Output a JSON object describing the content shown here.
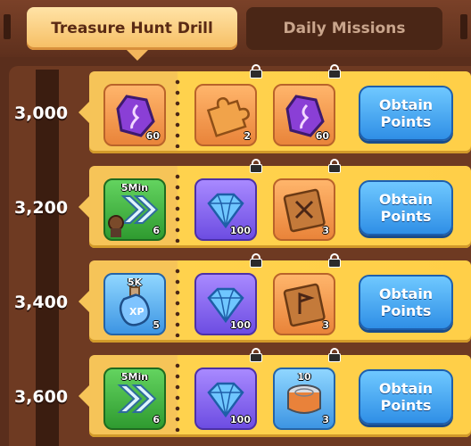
{
  "tabs": [
    {
      "label": "Treasure Hunt Drill",
      "active": true
    },
    {
      "label": "Daily Missions",
      "active": false
    }
  ],
  "rows": [
    {
      "points": "3,000",
      "button": "Obtain\nPoints",
      "rewards": [
        {
          "icon": "purple-rune-stone-icon",
          "qty": "60",
          "locked": false
        },
        {
          "icon": "puzzle-piece-icon",
          "qty": "2",
          "locked": true
        },
        {
          "icon": "purple-rune-stone-icon",
          "qty": "60",
          "locked": true
        }
      ]
    },
    {
      "points": "3,200",
      "button": "Obtain\nPoints",
      "rewards": [
        {
          "icon": "speedup-hero-icon",
          "tag": "5Min",
          "qty": "6",
          "locked": false
        },
        {
          "icon": "blue-diamond-icon",
          "qty": "100",
          "locked": true
        },
        {
          "icon": "crossed-swords-book-icon",
          "qty": "3",
          "locked": true
        }
      ]
    },
    {
      "points": "3,400",
      "button": "Obtain\nPoints",
      "rewards": [
        {
          "icon": "xp-potion-icon",
          "tag": "5K",
          "qty": "5",
          "locked": false
        },
        {
          "icon": "blue-diamond-icon",
          "qty": "100",
          "locked": true
        },
        {
          "icon": "flag-book-icon",
          "qty": "3",
          "locked": true
        }
      ]
    },
    {
      "points": "3,600",
      "button": "Obtain\nPoints",
      "rewards": [
        {
          "icon": "speedup-icon",
          "tag": "5Min",
          "qty": "6",
          "locked": false
        },
        {
          "icon": "blue-diamond-icon",
          "qty": "100",
          "locked": true
        },
        {
          "icon": "food-can-icon",
          "tag": "10",
          "qty": "3",
          "locked": true
        }
      ]
    }
  ]
}
